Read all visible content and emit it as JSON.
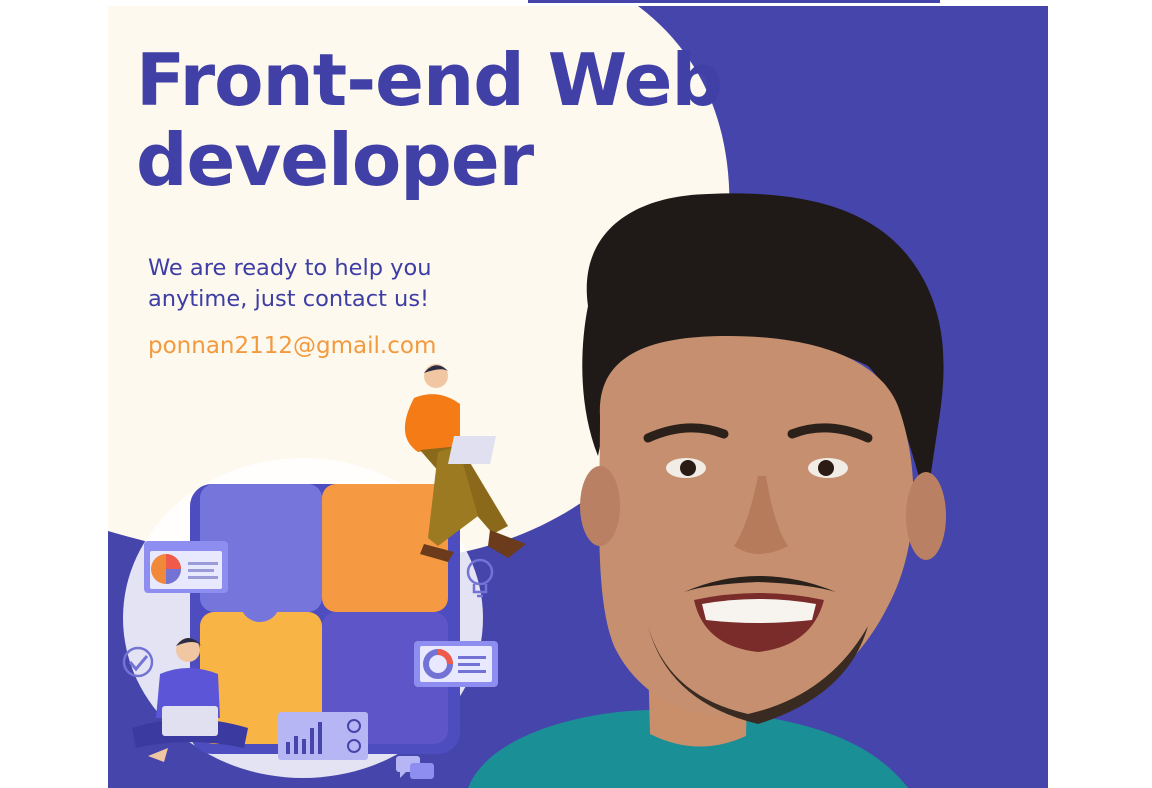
{
  "banner": {
    "headline_line1": "Front-end Web",
    "headline_line2": "developer",
    "tagline_line1": "We are ready to help you",
    "tagline_line2": "anytime, just contact us!",
    "email": "ponnan2112@gmail.com"
  },
  "colors": {
    "primary_purple": "#4545ab",
    "cream": "#fdf9ee",
    "accent_orange": "#f39a3f",
    "puzzle_purple": "#7070d8",
    "puzzle_yellow": "#f7b445",
    "shirt_teal": "#1b8f96"
  },
  "icons": [
    "puzzle-illustration",
    "pie-chart-card-icon",
    "bar-chart-card-icon",
    "donut-chart-card-icon",
    "lightbulb-icon",
    "checkmark-icon",
    "chat-bubbles-icon",
    "person-with-laptop-sitting",
    "person-with-laptop-cross-legged"
  ]
}
